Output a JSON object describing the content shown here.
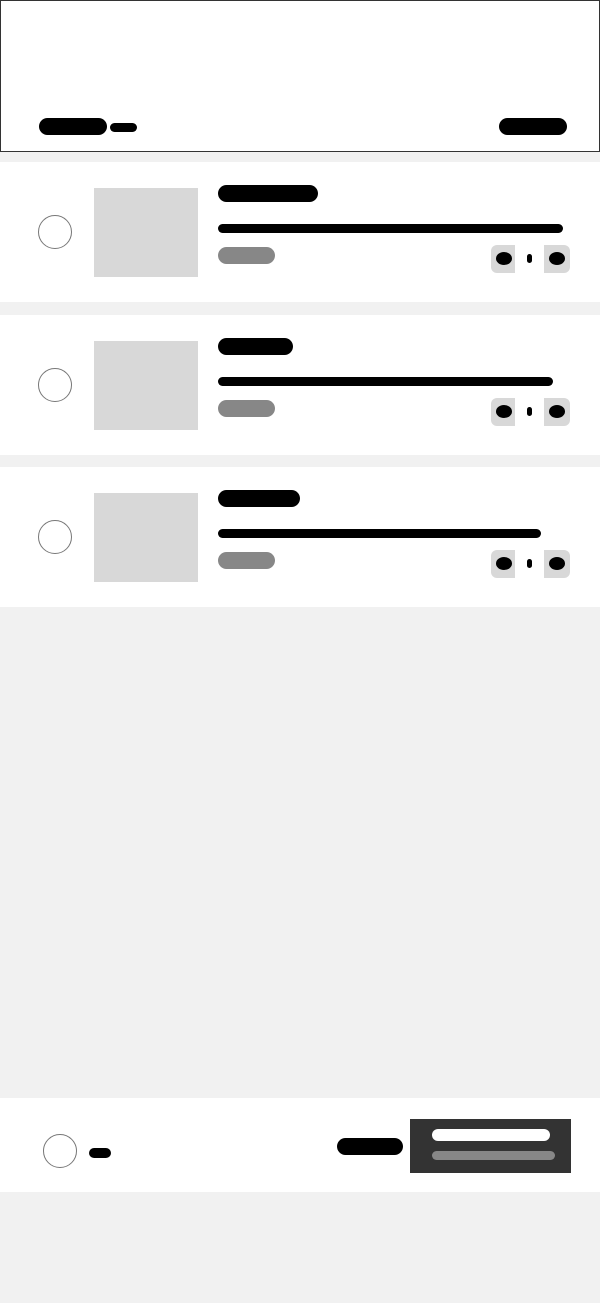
{
  "header": {
    "title_placeholder": "",
    "count_placeholder": "",
    "edit_placeholder": ""
  },
  "cart": {
    "items": [
      {
        "name_placeholder": "",
        "desc_placeholder": "",
        "price_placeholder": "",
        "quantity_placeholder": ""
      },
      {
        "name_placeholder": "",
        "desc_placeholder": "",
        "price_placeholder": "",
        "quantity_placeholder": ""
      },
      {
        "name_placeholder": "",
        "desc_placeholder": "",
        "price_placeholder": "",
        "quantity_placeholder": ""
      }
    ]
  },
  "footer": {
    "select_all_placeholder": "",
    "total_placeholder": "",
    "checkout": {
      "label_placeholder": "",
      "sub_placeholder": ""
    }
  },
  "colors": {
    "page_background": "#f1f1f1",
    "surface": "#ffffff",
    "text_block": "#000000",
    "muted_block": "#878787",
    "image_placeholder": "#d8d8d8",
    "checkout_background": "#333333"
  }
}
